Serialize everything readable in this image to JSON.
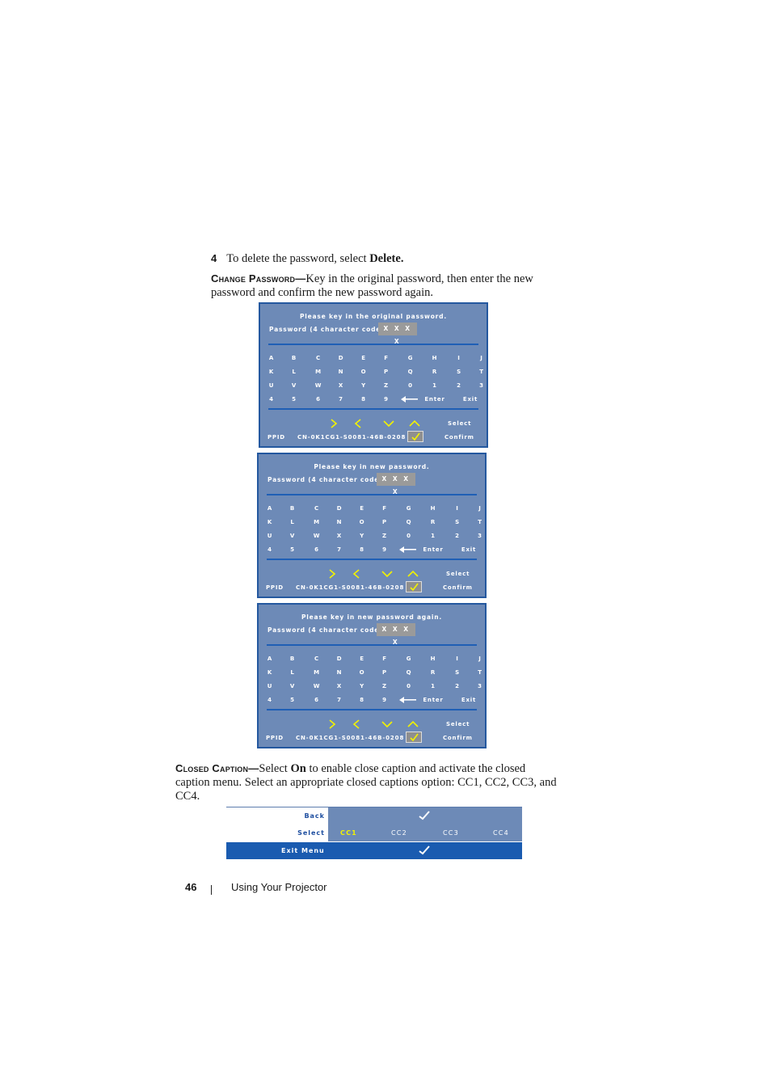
{
  "step": {
    "number": "4",
    "text_before": "To delete the password, select ",
    "text_bold": "Delete."
  },
  "change_password": {
    "heading": "Change Password",
    "dash": "—",
    "line1": "Key in the original password, then enter the new",
    "line2": "password and confirm the new password again."
  },
  "osd_common": {
    "password_label": "Password (4 character code):",
    "password_value": "X X X X",
    "keys": [
      [
        "A",
        "B",
        "C",
        "D",
        "E",
        "F",
        "G",
        "H",
        "I",
        "J"
      ],
      [
        "K",
        "L",
        "M",
        "N",
        "O",
        "P",
        "Q",
        "R",
        "S",
        "T"
      ],
      [
        "U",
        "V",
        "W",
        "X",
        "Y",
        "Z",
        "0",
        "1",
        "2",
        "3"
      ],
      [
        "4",
        "5",
        "6",
        "7",
        "8",
        "9"
      ]
    ],
    "enter_label": "Enter",
    "exit_label": "Exit",
    "select_label": "Select",
    "ppid_label": "PPID",
    "ppid_value": "CN-0K1CG1-S0081-46B-0208",
    "confirm_label": "Confirm",
    "nav_icons": [
      "chevron-right-icon",
      "chevron-left-icon",
      "chevron-down-icon",
      "chevron-up-icon"
    ],
    "accent_yellow": "#f2f200",
    "panel_color": "#6d8ab7",
    "border_color": "#24589f"
  },
  "dialogs": [
    {
      "title": "Please key in the original password."
    },
    {
      "title": "Please key in new password."
    },
    {
      "title": "Please key in new password again."
    }
  ],
  "closed_caption": {
    "heading": "Closed Caption",
    "dash": "—",
    "text_a": "Select ",
    "text_bold": "On",
    "text_b": " to enable close caption and activate the closed",
    "line2": "caption menu. Select an appropriate closed captions option: CC1, CC2, CC3, and",
    "line3": "CC4."
  },
  "cc_menu": {
    "back_label": "Back",
    "select_label": "Select",
    "exit_label": "Exit Menu",
    "options": [
      "CC1",
      "CC2",
      "CC3",
      "CC4"
    ],
    "selected": "CC1",
    "highlight_color": "#1a5bb0"
  },
  "footer": {
    "page_number": "46",
    "section": "Using Your Projector"
  }
}
